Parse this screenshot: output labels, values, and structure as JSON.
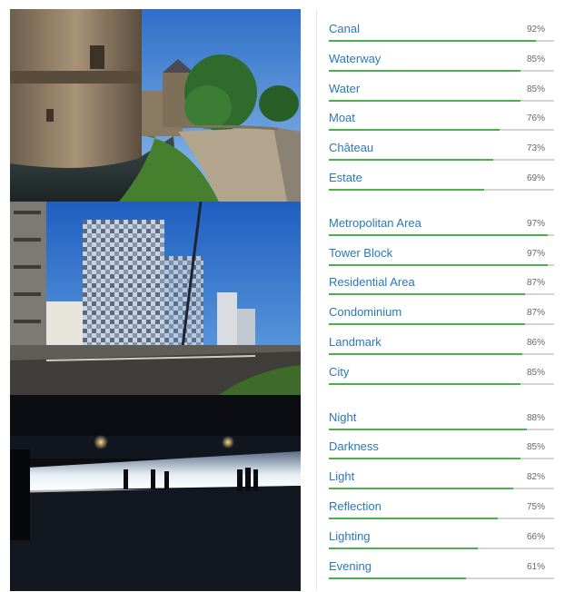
{
  "colors": {
    "label": "#2a79b8",
    "bar_fill": "#4cae4c",
    "bar_track": "#d4d4d4",
    "percent": "#666666"
  },
  "groups": [
    {
      "tags": [
        {
          "label": "Canal",
          "percent": "92%",
          "value": 92
        },
        {
          "label": "Waterway",
          "percent": "85%",
          "value": 85
        },
        {
          "label": "Water",
          "percent": "85%",
          "value": 85
        },
        {
          "label": "Moat",
          "percent": "76%",
          "value": 76
        },
        {
          "label": "Château",
          "percent": "73%",
          "value": 73
        },
        {
          "label": "Estate",
          "percent": "69%",
          "value": 69
        }
      ]
    },
    {
      "tags": [
        {
          "label": "Metropolitan Area",
          "percent": "97%",
          "value": 97
        },
        {
          "label": "Tower Block",
          "percent": "97%",
          "value": 97
        },
        {
          "label": "Residential Area",
          "percent": "87%",
          "value": 87
        },
        {
          "label": "Condominium",
          "percent": "87%",
          "value": 87
        },
        {
          "label": "Landmark",
          "percent": "86%",
          "value": 86
        },
        {
          "label": "City",
          "percent": "85%",
          "value": 85
        }
      ]
    },
    {
      "tags": [
        {
          "label": "Night",
          "percent": "88%",
          "value": 88
        },
        {
          "label": "Darkness",
          "percent": "85%",
          "value": 85
        },
        {
          "label": "Light",
          "percent": "82%",
          "value": 82
        },
        {
          "label": "Reflection",
          "percent": "75%",
          "value": 75
        },
        {
          "label": "Lighting",
          "percent": "66%",
          "value": 66
        },
        {
          "label": "Evening",
          "percent": "61%",
          "value": 61
        }
      ]
    }
  ]
}
